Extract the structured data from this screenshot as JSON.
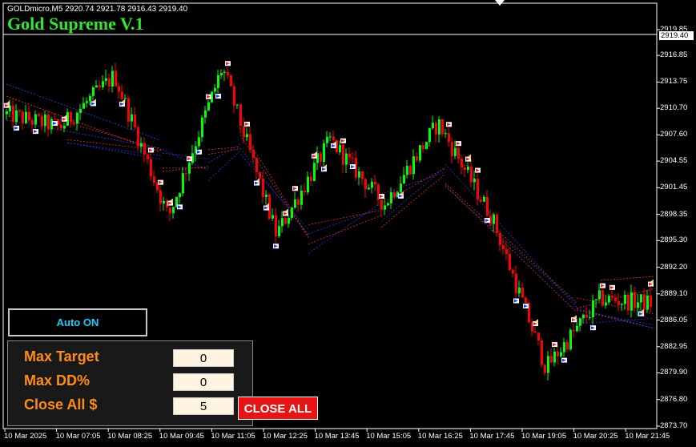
{
  "header": {
    "symbol_info": "GOLDmicro,M5  2920.74 2921.78 2916.43 2919.40",
    "ea_title": "Gold Supreme V.1",
    "ea_title_color": "#32e632"
  },
  "price_axis": {
    "current_price": "2919.40",
    "labels": [
      "2919.85",
      "2916.85",
      "2913.75",
      "2910.70",
      "2907.60",
      "2904.55",
      "2901.45",
      "2898.35",
      "2895.30",
      "2892.20",
      "2889.10",
      "2886.05",
      "2882.95",
      "2879.90",
      "2876.80",
      "2873.70"
    ]
  },
  "time_axis": {
    "labels": [
      "10 Mar 2025",
      "10 Mar 07:05",
      "10 Mar 08:25",
      "10 Mar 09:45",
      "10 Mar 11:05",
      "10 Mar 12:25",
      "10 Mar 13:45",
      "10 Mar 15:05",
      "10 Mar 16:25",
      "10 Mar 17:45",
      "10 Mar 19:05",
      "10 Mar 20:25",
      "10 Mar 21:45"
    ]
  },
  "controls": {
    "auto_button": "Auto ON",
    "max_target_label": "Max Target",
    "max_target_value": "0",
    "max_dd_label": "Max DD%",
    "max_dd_value": "0",
    "close_all_label": "Close All $",
    "close_all_value": "5",
    "close_all_button": "CLOSE ALL"
  },
  "colors": {
    "bull_candle": "#00ff00",
    "bear_candle": "#ff0000",
    "trade_line_buy": "#3c3cff",
    "trade_line_sell": "#ff3c3c",
    "accent_orange": "#ff8c19"
  },
  "chart_data": {
    "type": "candlestick",
    "symbol": "GOLDmicro",
    "timeframe": "M5",
    "ohlc_last": {
      "open": 2920.74,
      "high": 2921.78,
      "low": 2916.43,
      "close": 2919.4
    },
    "ylim": [
      2873.7,
      2921.0
    ],
    "price_path": [
      {
        "t": "10 Mar 2025",
        "price": 2910.0
      },
      {
        "t": "10 Mar 07:05",
        "price": 2908.5
      },
      {
        "t": "10 Mar 08:25",
        "price": 2914.5
      },
      {
        "t": "10 Mar 09:45",
        "price": 2898.0
      },
      {
        "t": "10 Mar 11:05",
        "price": 2915.5
      },
      {
        "t": "10 Mar 12:25",
        "price": 2896.0
      },
      {
        "t": "10 Mar 13:45",
        "price": 2907.0
      },
      {
        "t": "10 Mar 15:05",
        "price": 2899.5
      },
      {
        "t": "10 Mar 16:25",
        "price": 2909.0
      },
      {
        "t": "10 Mar 17:45",
        "price": 2898.0
      },
      {
        "t": "10 Mar 19:05",
        "price": 2880.5
      },
      {
        "t": "10 Mar 20:25",
        "price": 2888.5
      },
      {
        "t": "10 Mar 21:45",
        "price": 2888.0
      }
    ]
  }
}
